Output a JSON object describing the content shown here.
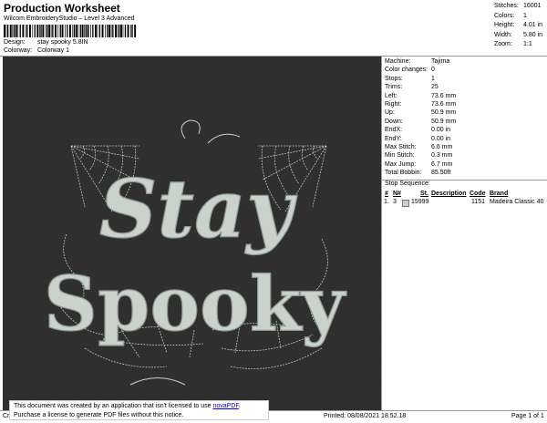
{
  "header": {
    "title": "Production Worksheet",
    "software": "Wilcom EmbroideryStudio – Level 3 Advanced",
    "design_label": "Design:",
    "design_value": "stay spooky 5.8IN",
    "colorway_label": "Colorway:",
    "colorway_value": "Colorway 1"
  },
  "stats": [
    {
      "k": "Stitches:",
      "v": "16001"
    },
    {
      "k": "Colors:",
      "v": "1"
    },
    {
      "k": "Height:",
      "v": "4.01 in"
    },
    {
      "k": "Width:",
      "v": "5.80 in"
    },
    {
      "k": "Zoom:",
      "v": "1:1"
    }
  ],
  "machine_info": [
    {
      "k": "Machine:",
      "v": "Tajima"
    },
    {
      "k": "Color changes:",
      "v": "0"
    },
    {
      "k": "Stops:",
      "v": "1"
    },
    {
      "k": "Trims:",
      "v": "25"
    },
    {
      "k": "Left:",
      "v": "73.6 mm"
    },
    {
      "k": "Right:",
      "v": "73.6 mm"
    },
    {
      "k": "Up:",
      "v": "50.9 mm"
    },
    {
      "k": "Down:",
      "v": "50.9 mm"
    },
    {
      "k": "EndX:",
      "v": "0.00 in"
    },
    {
      "k": "EndY:",
      "v": "0.00 in"
    },
    {
      "k": "Max Stitch:",
      "v": "6.6 mm"
    },
    {
      "k": "Min Stitch:",
      "v": "0.3 mm"
    },
    {
      "k": "Max Jump:",
      "v": "6.7 mm"
    },
    {
      "k": "Total Bobbin:",
      "v": "85.50ft"
    }
  ],
  "stop_sequence": {
    "title": "Stop Sequence:",
    "headers": [
      "#",
      "N#",
      "St.",
      "Description",
      "Code",
      "Brand"
    ],
    "rows": [
      {
        "num": "1.",
        "n": "3",
        "st": "15999",
        "desc": "",
        "code": "1151",
        "brand": "Madeira Classic 40"
      }
    ],
    "swatch_color": "#c9cfc9"
  },
  "design_text": {
    "line1": "Stay",
    "line2": "Spooky"
  },
  "colors": {
    "canvas": "#2e2e2e",
    "thread": "#c9d2cb"
  },
  "footer": {
    "left": "Cr",
    "printed": "Printed: 08/08/2021 18.52.18",
    "page": "Page 1 of 1"
  },
  "notice": {
    "line1_pre": "This document was created by an application that isn't licensed to use ",
    "link": "novaPDF",
    "line1_post": ".",
    "line2": "Purchase a license to generate PDF files without this notice."
  }
}
